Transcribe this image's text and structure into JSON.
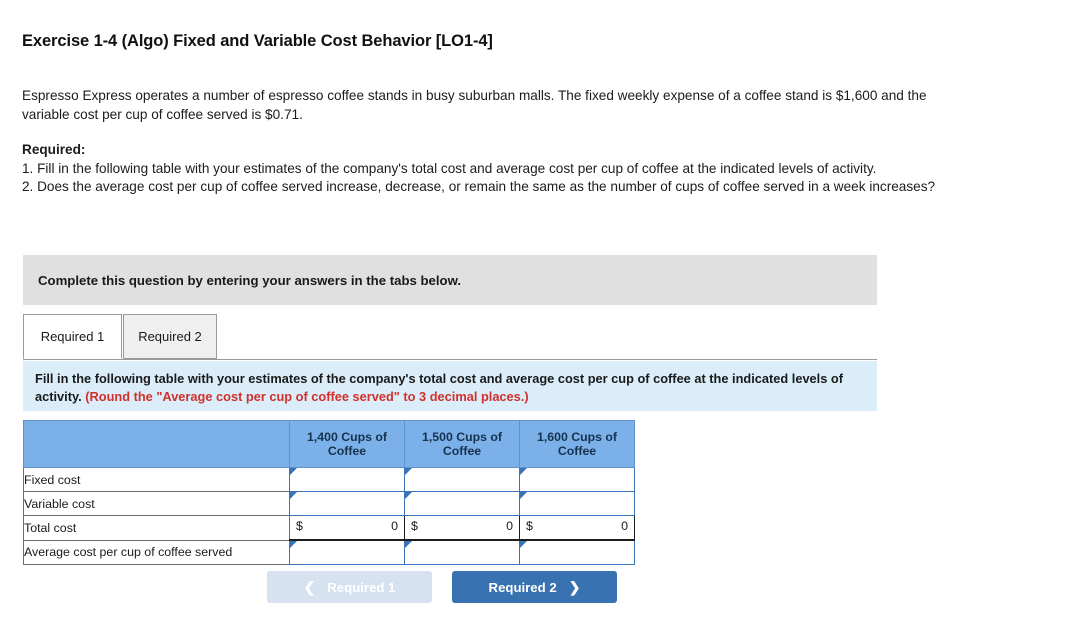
{
  "exercise": {
    "title": "Exercise 1-4 (Algo) Fixed and Variable Cost Behavior [LO1-4]",
    "intro": "Espresso Express operates a number of espresso coffee stands in busy suburban malls. The fixed weekly expense of a coffee stand is $1,600 and the variable cost per cup of coffee served is $0.71.",
    "required_heading": "Required:",
    "required_1": "1. Fill in the following table with your estimates of the company's total cost and average cost per cup of coffee at the indicated levels of activity.",
    "required_2": "2. Does the average cost per cup of coffee served increase, decrease, or remain the same as the number of cups of coffee served in a week increases?"
  },
  "banner": {
    "text": "Complete this question by entering your answers in the tabs below."
  },
  "tabs": [
    {
      "label": "Required 1",
      "active": true
    },
    {
      "label": "Required 2",
      "active": false
    }
  ],
  "instruction_panel": {
    "main": "Fill in the following table with your estimates of the company's total cost and average cost per cup of coffee at the indicated levels of activity.",
    "round_note": "(Round the \"Average cost per cup of coffee served\" to 3 decimal places.)"
  },
  "table": {
    "corner_header": "",
    "column_headers": [
      "1,400 Cups of Coffee",
      "1,500 Cups of Coffee",
      "1,600 Cups of Coffee"
    ],
    "rows": [
      {
        "label": "Fixed cost",
        "type": "input",
        "values": [
          "",
          "",
          ""
        ]
      },
      {
        "label": "Variable cost",
        "type": "input",
        "values": [
          "",
          "",
          ""
        ]
      },
      {
        "label": "Total cost",
        "type": "total",
        "currency": "$",
        "values": [
          "0",
          "0",
          "0"
        ]
      },
      {
        "label": "Average cost per cup of coffee served",
        "type": "input",
        "values": [
          "",
          "",
          ""
        ]
      }
    ]
  },
  "nav": {
    "prev_label": "Required 1",
    "prev_icon": "chevron-left-icon",
    "prev_disabled": true,
    "next_label": "Required 2",
    "next_icon": "chevron-right-icon"
  },
  "colors": {
    "table_header_blue": "#7cb0e8",
    "panel_blue": "#daedf9",
    "banner_gray": "#e0e0e0",
    "primary_button": "#3872b0",
    "disabled_button": "#d6e2f0",
    "round_note_red": "#d2302c",
    "input_border_blue": "#3b73b9"
  }
}
